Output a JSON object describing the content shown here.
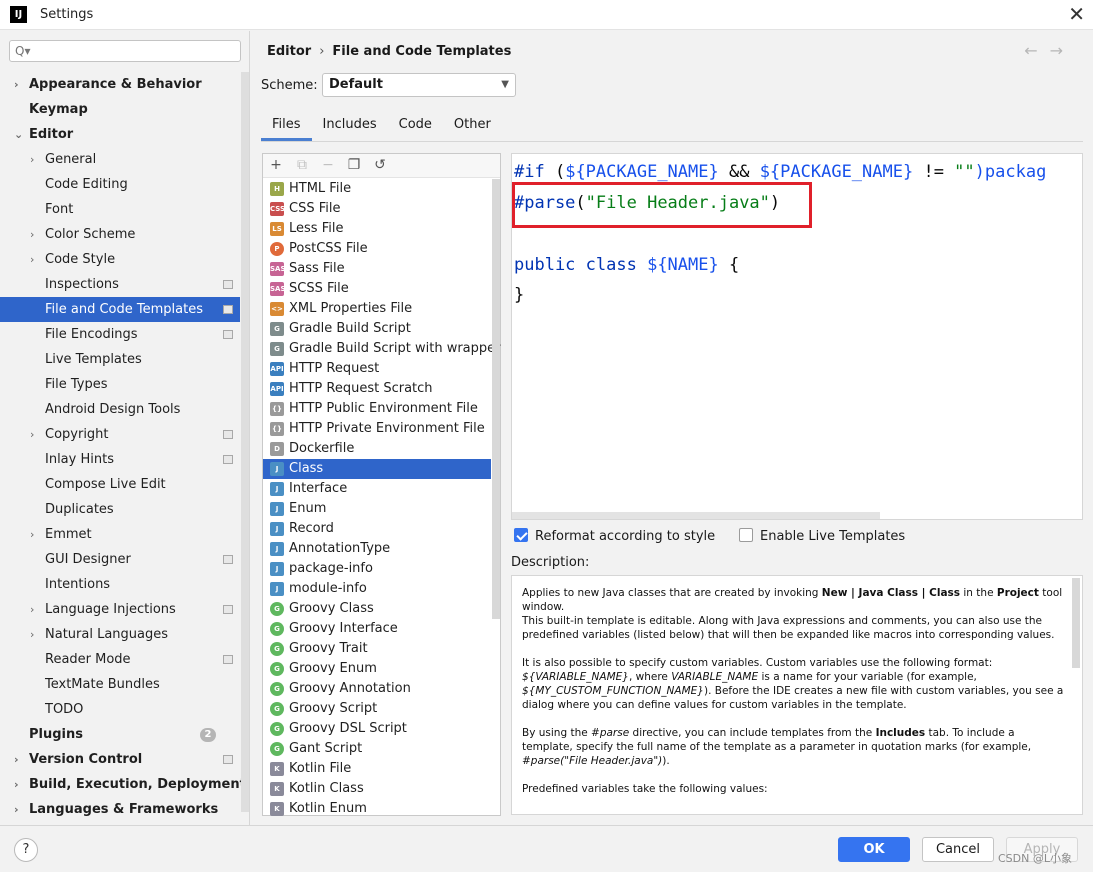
{
  "window": {
    "app_logo": "IJ",
    "title": "Settings",
    "close": "✕"
  },
  "search": {
    "placeholder": "Q▾",
    "value": ""
  },
  "sidebar": {
    "items": [
      {
        "label": "Appearance & Behavior",
        "bold": true,
        "level": 0,
        "arrow": "›",
        "badge": false
      },
      {
        "label": "Keymap",
        "bold": true,
        "level": 0,
        "arrow": "",
        "badge": false
      },
      {
        "label": "Editor",
        "bold": true,
        "level": 0,
        "arrow": "⌄",
        "badge": false
      },
      {
        "label": "General",
        "bold": false,
        "level": 1,
        "arrow": "›",
        "badge": false
      },
      {
        "label": "Code Editing",
        "bold": false,
        "level": 1,
        "arrow": "",
        "badge": false
      },
      {
        "label": "Font",
        "bold": false,
        "level": 1,
        "arrow": "",
        "badge": false
      },
      {
        "label": "Color Scheme",
        "bold": false,
        "level": 1,
        "arrow": "›",
        "badge": false
      },
      {
        "label": "Code Style",
        "bold": false,
        "level": 1,
        "arrow": "›",
        "badge": false
      },
      {
        "label": "Inspections",
        "bold": false,
        "level": 1,
        "arrow": "",
        "badge": true
      },
      {
        "label": "File and Code Templates",
        "bold": false,
        "level": 1,
        "arrow": "",
        "badge": true,
        "selected": true
      },
      {
        "label": "File Encodings",
        "bold": false,
        "level": 1,
        "arrow": "",
        "badge": true
      },
      {
        "label": "Live Templates",
        "bold": false,
        "level": 1,
        "arrow": "",
        "badge": false
      },
      {
        "label": "File Types",
        "bold": false,
        "level": 1,
        "arrow": "",
        "badge": false
      },
      {
        "label": "Android Design Tools",
        "bold": false,
        "level": 1,
        "arrow": "",
        "badge": false
      },
      {
        "label": "Copyright",
        "bold": false,
        "level": 1,
        "arrow": "›",
        "badge": true
      },
      {
        "label": "Inlay Hints",
        "bold": false,
        "level": 1,
        "arrow": "",
        "badge": true
      },
      {
        "label": "Compose Live Edit",
        "bold": false,
        "level": 1,
        "arrow": "",
        "badge": false
      },
      {
        "label": "Duplicates",
        "bold": false,
        "level": 1,
        "arrow": "",
        "badge": false
      },
      {
        "label": "Emmet",
        "bold": false,
        "level": 1,
        "arrow": "›",
        "badge": false
      },
      {
        "label": "GUI Designer",
        "bold": false,
        "level": 1,
        "arrow": "",
        "badge": true
      },
      {
        "label": "Intentions",
        "bold": false,
        "level": 1,
        "arrow": "",
        "badge": false
      },
      {
        "label": "Language Injections",
        "bold": false,
        "level": 1,
        "arrow": "›",
        "badge": true
      },
      {
        "label": "Natural Languages",
        "bold": false,
        "level": 1,
        "arrow": "›",
        "badge": false
      },
      {
        "label": "Reader Mode",
        "bold": false,
        "level": 1,
        "arrow": "",
        "badge": true
      },
      {
        "label": "TextMate Bundles",
        "bold": false,
        "level": 1,
        "arrow": "",
        "badge": false
      },
      {
        "label": "TODO",
        "bold": false,
        "level": 1,
        "arrow": "",
        "badge": false
      },
      {
        "label": "Plugins",
        "bold": true,
        "level": 0,
        "arrow": "",
        "badge": false,
        "count": "2"
      },
      {
        "label": "Version Control",
        "bold": true,
        "level": 0,
        "arrow": "›",
        "badge": true
      },
      {
        "label": "Build, Execution, Deployment",
        "bold": true,
        "level": 0,
        "arrow": "›",
        "badge": false
      },
      {
        "label": "Languages & Frameworks",
        "bold": true,
        "level": 0,
        "arrow": "›",
        "badge": false
      }
    ]
  },
  "header": {
    "breadcrumb_parent": "Editor",
    "breadcrumb_sep": "›",
    "breadcrumb_current": "File and Code Templates",
    "back": "←",
    "forward": "→"
  },
  "scheme": {
    "label": "Scheme:",
    "value": "Default",
    "dropdown": "▼"
  },
  "tabs": [
    "Files",
    "Includes",
    "Code",
    "Other"
  ],
  "toolbar": {
    "add": "+",
    "copy_add": "⧉",
    "remove": "−",
    "copy": "❐",
    "reset": "↺"
  },
  "templates": [
    {
      "label": "HTML File",
      "icon": "H",
      "color": "#9aa74a"
    },
    {
      "label": "CSS File",
      "icon": "CSS",
      "color": "#c94e4e"
    },
    {
      "label": "Less File",
      "icon": "LS",
      "color": "#d98a34"
    },
    {
      "label": "PostCSS File",
      "icon": "P",
      "color": "#e06a3a",
      "round": true
    },
    {
      "label": "Sass File",
      "icon": "SASS",
      "color": "#c76494"
    },
    {
      "label": "SCSS File",
      "icon": "SASS",
      "color": "#c76494"
    },
    {
      "label": "XML Properties File",
      "icon": "<>",
      "color": "#d98a34"
    },
    {
      "label": "Gradle Build Script",
      "icon": "G",
      "color": "#7e8c8c"
    },
    {
      "label": "Gradle Build Script with wrapper",
      "icon": "G",
      "color": "#7e8c8c"
    },
    {
      "label": "HTTP Request",
      "icon": "API",
      "color": "#3a7fbf"
    },
    {
      "label": "HTTP Request Scratch",
      "icon": "API",
      "color": "#3a7fbf"
    },
    {
      "label": "HTTP Public Environment File",
      "icon": "{}",
      "color": "#9a9a9a"
    },
    {
      "label": "HTTP Private Environment File",
      "icon": "{}",
      "color": "#9a9a9a"
    },
    {
      "label": "Dockerfile",
      "icon": "D",
      "color": "#9a9a9a"
    },
    {
      "label": "Class",
      "icon": "J",
      "color": "#4a8fc4",
      "selected": true
    },
    {
      "label": "Interface",
      "icon": "J",
      "color": "#4a8fc4"
    },
    {
      "label": "Enum",
      "icon": "J",
      "color": "#4a8fc4"
    },
    {
      "label": "Record",
      "icon": "J",
      "color": "#4a8fc4"
    },
    {
      "label": "AnnotationType",
      "icon": "J",
      "color": "#4a8fc4"
    },
    {
      "label": "package-info",
      "icon": "J",
      "color": "#4a8fc4"
    },
    {
      "label": "module-info",
      "icon": "J",
      "color": "#4a8fc4"
    },
    {
      "label": "Groovy Class",
      "icon": "G",
      "color": "#5fb85f",
      "round": true
    },
    {
      "label": "Groovy Interface",
      "icon": "G",
      "color": "#5fb85f",
      "round": true
    },
    {
      "label": "Groovy Trait",
      "icon": "G",
      "color": "#5fb85f",
      "round": true
    },
    {
      "label": "Groovy Enum",
      "icon": "G",
      "color": "#5fb85f",
      "round": true
    },
    {
      "label": "Groovy Annotation",
      "icon": "G",
      "color": "#5fb85f",
      "round": true
    },
    {
      "label": "Groovy Script",
      "icon": "G",
      "color": "#5fb85f",
      "round": true
    },
    {
      "label": "Groovy DSL Script",
      "icon": "G",
      "color": "#5fb85f",
      "round": true
    },
    {
      "label": "Gant Script",
      "icon": "G",
      "color": "#5fb85f",
      "round": true
    },
    {
      "label": "Kotlin File",
      "icon": "K",
      "color": "#8a8a9a"
    },
    {
      "label": "Kotlin Class",
      "icon": "K",
      "color": "#8a8a9a"
    },
    {
      "label": "Kotlin Enum",
      "icon": "K",
      "color": "#8a8a9a"
    }
  ],
  "editor": {
    "line1": {
      "kw": "#if",
      "a": " (",
      "v1": "${PACKAGE_NAME}",
      "b": " && ",
      "v2": "${PACKAGE_NAME}",
      "c": " != ",
      "s": "\"\"",
      "d": ")packag"
    },
    "line2": {
      "kw": "#parse",
      "a": "(",
      "s": "\"File Header.java\"",
      "b": ")"
    },
    "line4": {
      "kw": "public class",
      "a": " ",
      "v": "${NAME}",
      "b": " {"
    },
    "line5": "}"
  },
  "options": {
    "reformat_label": "Reformat according to style",
    "reformat_checked": true,
    "live_label": "Enable Live Templates",
    "live_checked": false
  },
  "description": {
    "label": "Description:",
    "p1_a": "Applies to new Java classes that are created by invoking ",
    "p1_b": "New | Java Class | Class",
    "p1_c": " in the ",
    "p1_d": "Project",
    "p1_e": " tool window.",
    "p1_f": "This built-in template is editable. Along with Java expressions and comments, you can also use the predefined variables (listed below) that will then be expanded like macros into corresponding values.",
    "p2_a": "It is also possible to specify custom variables. Custom variables use the following format: ",
    "p2_b": "${VARIABLE_NAME}",
    "p2_c": ", where ",
    "p2_d": "VARIABLE_NAME",
    "p2_e": " is a name for your variable (for example, ",
    "p2_f": "${MY_CUSTOM_FUNCTION_NAME}",
    "p2_g": "). Before the IDE creates a new file with custom variables, you see a dialog where you can define values for custom variables in the template.",
    "p3_a": "By using the ",
    "p3_b": "#parse",
    "p3_c": " directive, you can include templates from the ",
    "p3_d": "Includes",
    "p3_e": " tab. To include a template, specify the full name of the template as a parameter in quotation marks (for example, ",
    "p3_f": "#parse(\"File Header.java\")",
    "p3_g": ").",
    "p4": "Predefined variables take the following values:"
  },
  "footer": {
    "help": "?",
    "ok": "OK",
    "cancel": "Cancel",
    "apply": "Apply",
    "watermark": "CSDN @L小象"
  },
  "colors": {
    "accent": "#3574f0",
    "selection": "#2f65ca",
    "highlight": "#e0202a"
  }
}
